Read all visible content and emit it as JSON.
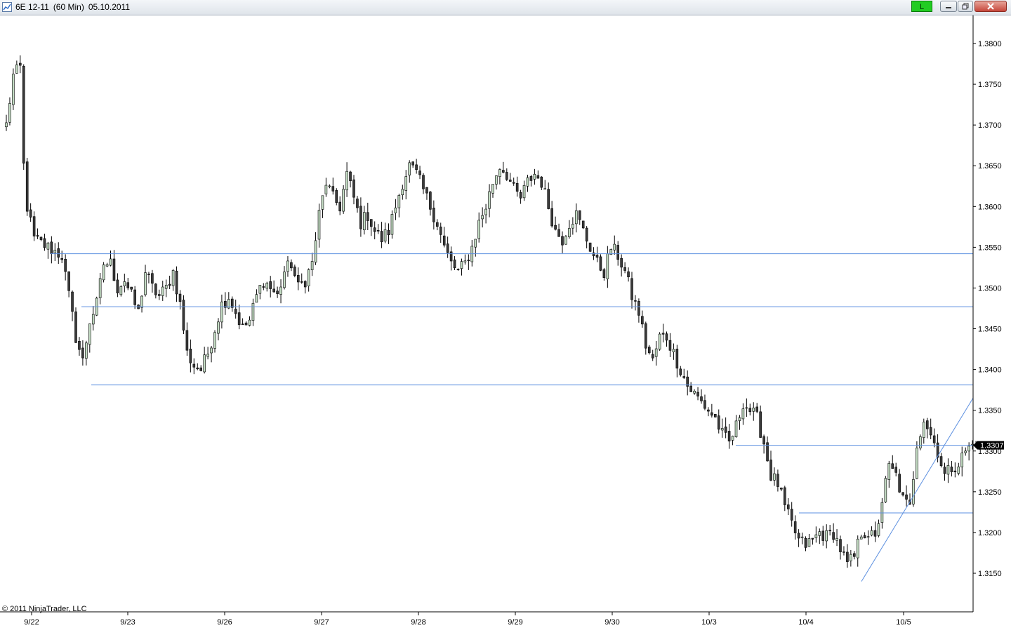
{
  "window": {
    "instrument": "6E 12-11",
    "interval": "(60 Min)",
    "date": "05.10.2011",
    "link_label": "L"
  },
  "colors": {
    "up_body": "#c3dcc3",
    "down_body": "#3a3a3a",
    "level_line": "#5b8fe0",
    "link_green": "#22cc22"
  },
  "copyright": "© 2011 NinjaTrader, LLC",
  "chart_data": {
    "type": "candlestick",
    "y_ticks": [
      "1.3800",
      "1.3750",
      "1.3700",
      "1.3650",
      "1.3600",
      "1.3550",
      "1.3500",
      "1.3450",
      "1.3400",
      "1.3350",
      "1.3300",
      "1.3250",
      "1.3200",
      "1.3150"
    ],
    "x_ticks": [
      "9/22",
      "9/23",
      "9/26",
      "9/27",
      "9/28",
      "9/29",
      "9/30",
      "10/3",
      "10/4",
      "10/5"
    ],
    "ylim": [
      1.311,
      1.3835
    ],
    "last_price": 1.3307,
    "last_price_label": "1.3307",
    "horizontal_levels": [
      1.3542,
      1.3477,
      1.3381,
      1.3307,
      1.3224
    ],
    "trendline": {
      "from": [
        "10/4",
        1.314
      ],
      "to": [
        "10/5",
        1.3365
      ]
    },
    "anchors": [
      [
        0,
        1.37
      ],
      [
        2,
        1.376
      ],
      [
        4,
        1.377
      ],
      [
        5,
        1.365
      ],
      [
        6,
        1.36
      ],
      [
        8,
        1.356
      ],
      [
        12,
        1.355
      ],
      [
        16,
        1.354
      ],
      [
        18,
        1.349
      ],
      [
        20,
        1.344
      ],
      [
        22,
        1.341
      ],
      [
        24,
        1.346
      ],
      [
        26,
        1.348
      ],
      [
        28,
        1.353
      ],
      [
        30,
        1.353
      ],
      [
        32,
        1.35
      ],
      [
        34,
        1.351
      ],
      [
        36,
        1.349
      ],
      [
        38,
        1.347
      ],
      [
        40,
        1.352
      ],
      [
        42,
        1.35
      ],
      [
        44,
        1.349
      ],
      [
        46,
        1.35
      ],
      [
        48,
        1.352
      ],
      [
        50,
        1.348
      ],
      [
        52,
        1.342
      ],
      [
        54,
        1.3405
      ],
      [
        56,
        1.34
      ],
      [
        58,
        1.342
      ],
      [
        60,
        1.345
      ],
      [
        62,
        1.348
      ],
      [
        64,
        1.349
      ],
      [
        66,
        1.347
      ],
      [
        68,
        1.345
      ],
      [
        70,
        1.346
      ],
      [
        72,
        1.349
      ],
      [
        74,
        1.351
      ],
      [
        76,
        1.35
      ],
      [
        78,
        1.349
      ],
      [
        80,
        1.352
      ],
      [
        82,
        1.353
      ],
      [
        84,
        1.35
      ],
      [
        86,
        1.351
      ],
      [
        88,
        1.353
      ],
      [
        90,
        1.359
      ],
      [
        92,
        1.363
      ],
      [
        94,
        1.361
      ],
      [
        96,
        1.36
      ],
      [
        98,
        1.364
      ],
      [
        100,
        1.361
      ],
      [
        102,
        1.358
      ],
      [
        104,
        1.359
      ],
      [
        106,
        1.357
      ],
      [
        108,
        1.356
      ],
      [
        110,
        1.357
      ],
      [
        112,
        1.36
      ],
      [
        114,
        1.363
      ],
      [
        116,
        1.365
      ],
      [
        118,
        1.364
      ],
      [
        120,
        1.362
      ],
      [
        122,
        1.36
      ],
      [
        124,
        1.358
      ],
      [
        126,
        1.355
      ],
      [
        128,
        1.353
      ],
      [
        130,
        1.352
      ],
      [
        132,
        1.353
      ],
      [
        134,
        1.355
      ],
      [
        136,
        1.358
      ],
      [
        138,
        1.36
      ],
      [
        140,
        1.363
      ],
      [
        142,
        1.365
      ],
      [
        144,
        1.364
      ],
      [
        146,
        1.362
      ],
      [
        148,
        1.361
      ],
      [
        150,
        1.363
      ],
      [
        152,
        1.364
      ],
      [
        154,
        1.363
      ],
      [
        156,
        1.36
      ],
      [
        158,
        1.357
      ],
      [
        160,
        1.356
      ],
      [
        162,
        1.358
      ],
      [
        164,
        1.359
      ],
      [
        166,
        1.357
      ],
      [
        168,
        1.355
      ],
      [
        170,
        1.353
      ],
      [
        172,
        1.352
      ],
      [
        174,
        1.355
      ],
      [
        176,
        1.354
      ],
      [
        178,
        1.352
      ],
      [
        180,
        1.349
      ],
      [
        182,
        1.347
      ],
      [
        184,
        1.343
      ],
      [
        186,
        1.341
      ],
      [
        188,
        1.344
      ],
      [
        190,
        1.344
      ],
      [
        192,
        1.342
      ],
      [
        194,
        1.34
      ],
      [
        196,
        1.338
      ],
      [
        198,
        1.337
      ],
      [
        200,
        1.336
      ],
      [
        202,
        1.335
      ],
      [
        204,
        1.334
      ],
      [
        206,
        1.332
      ],
      [
        208,
        1.331
      ],
      [
        210,
        1.333
      ],
      [
        212,
        1.336
      ],
      [
        214,
        1.335
      ],
      [
        216,
        1.334
      ],
      [
        218,
        1.331
      ],
      [
        220,
        1.327
      ],
      [
        222,
        1.326
      ],
      [
        224,
        1.323
      ],
      [
        226,
        1.321
      ],
      [
        228,
        1.319
      ],
      [
        230,
        1.3185
      ],
      [
        232,
        1.319
      ],
      [
        234,
        1.32
      ],
      [
        236,
        1.3195
      ],
      [
        238,
        1.32
      ],
      [
        240,
        1.318
      ],
      [
        242,
        1.316
      ],
      [
        244,
        1.317
      ],
      [
        246,
        1.32
      ],
      [
        248,
        1.32
      ],
      [
        250,
        1.319
      ],
      [
        252,
        1.324
      ],
      [
        254,
        1.328
      ],
      [
        256,
        1.327
      ],
      [
        258,
        1.324
      ],
      [
        260,
        1.323
      ],
      [
        262,
        1.331
      ],
      [
        264,
        1.334
      ],
      [
        266,
        1.332
      ],
      [
        268,
        1.33
      ],
      [
        270,
        1.327
      ],
      [
        272,
        1.328
      ],
      [
        274,
        1.3285
      ],
      [
        276,
        1.33
      ],
      [
        278,
        1.3307
      ]
    ]
  }
}
